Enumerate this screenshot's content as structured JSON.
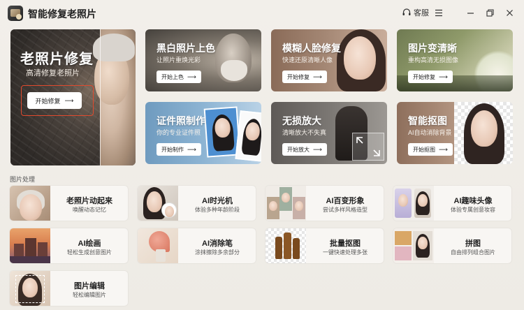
{
  "app": {
    "title": "智能修复老照片",
    "service_label": "客服"
  },
  "hero": {
    "title": "老照片修复",
    "subtitle": "高清修复老照片",
    "button": "开始修复"
  },
  "features": [
    {
      "title": "黑白照片上色",
      "subtitle": "让照片重焕光彩",
      "button": "开始上色"
    },
    {
      "title": "模糊人脸修复",
      "subtitle": "快速还原清晰人像",
      "button": "开始修复"
    },
    {
      "title": "图片变清晰",
      "subtitle": "重构高清无损图像",
      "button": "开始修复"
    },
    {
      "title": "证件照制作",
      "subtitle": "你的专业证件照",
      "button": "开始制作"
    },
    {
      "title": "无损放大",
      "subtitle": "清晰放大不失真",
      "button": "开始放大"
    },
    {
      "title": "智能抠图",
      "subtitle": "AI自动消除背景",
      "button": "开始抠图"
    }
  ],
  "section": {
    "label": "图片处理"
  },
  "tools": [
    {
      "title": "老照片动起来",
      "subtitle": "唤醒动态记忆"
    },
    {
      "title": "AI时光机",
      "subtitle": "体验多种年龄阶段"
    },
    {
      "title": "AI百变形象",
      "subtitle": "尝试多样风格造型"
    },
    {
      "title": "AI趣味头像",
      "subtitle": "体验专属创意妆容"
    },
    {
      "title": "AI绘画",
      "subtitle": "轻松生成创意图片"
    },
    {
      "title": "AI消除笔",
      "subtitle": "涂抹擦除多余部分"
    },
    {
      "title": "批量抠图",
      "subtitle": "一键快速处理多张"
    },
    {
      "title": "拼图",
      "subtitle": "自由排列组合图片"
    },
    {
      "title": "图片编辑",
      "subtitle": "轻松编辑图片"
    }
  ],
  "colors": {
    "accent": "#e04a2e",
    "background": "#f0ede8",
    "card": "#f8f6f3"
  }
}
